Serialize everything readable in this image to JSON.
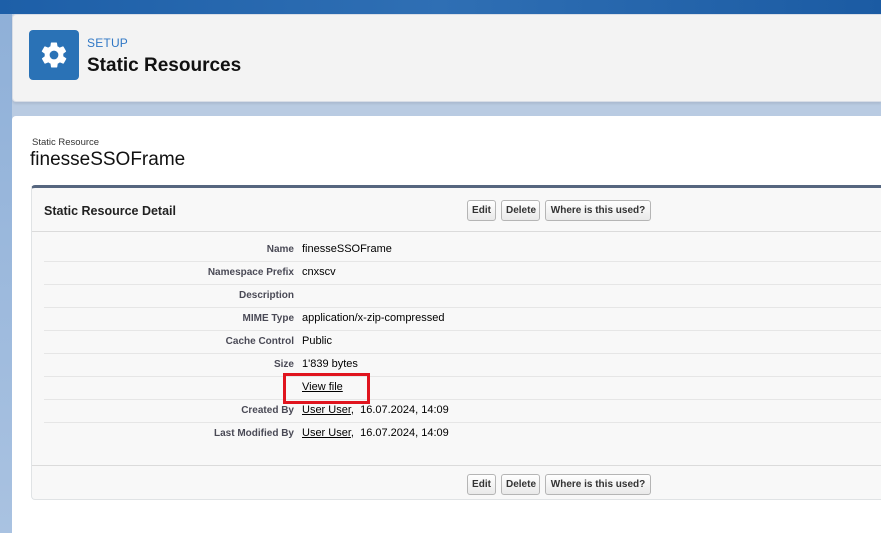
{
  "header": {
    "eyebrow": "SETUP",
    "title": "Static Resources",
    "icon": "gear-icon"
  },
  "resource": {
    "eyebrow": "Static Resource",
    "name": "finesseSSOFrame"
  },
  "detail": {
    "title": "Static Resource Detail",
    "buttons": {
      "edit": "Edit",
      "delete": "Delete",
      "where_used": "Where is this used?"
    },
    "fields": {
      "name": {
        "label": "Name",
        "value": "finesseSSOFrame"
      },
      "namespace": {
        "label": "Namespace Prefix",
        "value": "cnxscv"
      },
      "description": {
        "label": "Description",
        "value": ""
      },
      "mime": {
        "label": "MIME Type",
        "value": "application/x-zip-compressed"
      },
      "cache": {
        "label": "Cache Control",
        "value": "Public"
      },
      "size": {
        "label": "Size",
        "value": "1'839 bytes"
      },
      "view_file": {
        "label": "",
        "link": "View file"
      },
      "created_by": {
        "label": "Created By",
        "user": "User User",
        "date": "16.07.2024, 14:09"
      },
      "modified_by": {
        "label": "Last Modified By",
        "user": "User User",
        "date": "16.07.2024, 14:09"
      }
    }
  },
  "colors": {
    "header_icon_bg": "#2a72b6",
    "highlight": "#e0141e",
    "eyebrow_link": "#2f77c5"
  }
}
